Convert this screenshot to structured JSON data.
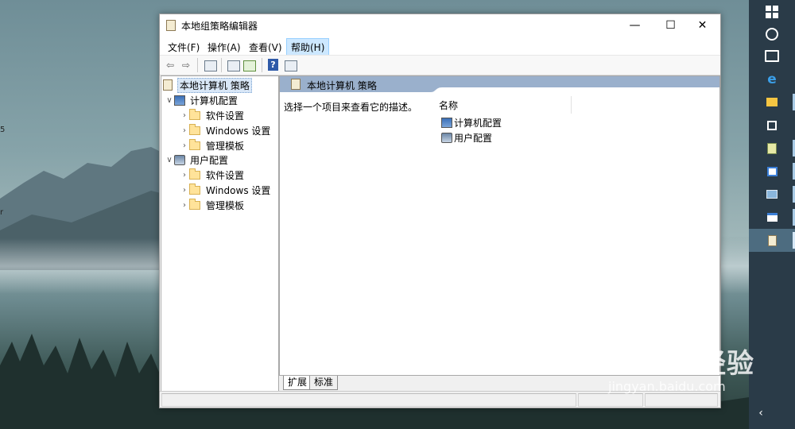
{
  "window": {
    "title": "本地组策略编辑器",
    "controls": {
      "minimize": "—",
      "maximize": "☐",
      "close": "✕"
    }
  },
  "menu": [
    {
      "label": "文件(F)"
    },
    {
      "label": "操作(A)"
    },
    {
      "label": "查看(V)"
    },
    {
      "label": "帮助(H)"
    }
  ],
  "toolbar": {
    "back_icon": "⇦",
    "forward_icon": "⇨",
    "help_icon": "?"
  },
  "tree": {
    "root": "本地计算机 策略",
    "computer_config": "计算机配置",
    "user_config": "用户配置",
    "children": {
      "software": "软件设置",
      "windows": "Windows 设置",
      "admin": "管理模板"
    }
  },
  "content": {
    "header_title": "本地计算机 策略",
    "description": "选择一个项目来查看它的描述。",
    "column_name": "名称",
    "items": [
      "计算机配置",
      "用户配置"
    ]
  },
  "tabs": {
    "extended": "扩展",
    "standard": "标准"
  },
  "desktop": {
    "edge_text_1": "5",
    "edge_text_2": "r"
  },
  "watermark": {
    "main": "Baidu经验",
    "sub": "jingyan.baidu.com"
  },
  "taskbar": {
    "chevron": "‹"
  }
}
